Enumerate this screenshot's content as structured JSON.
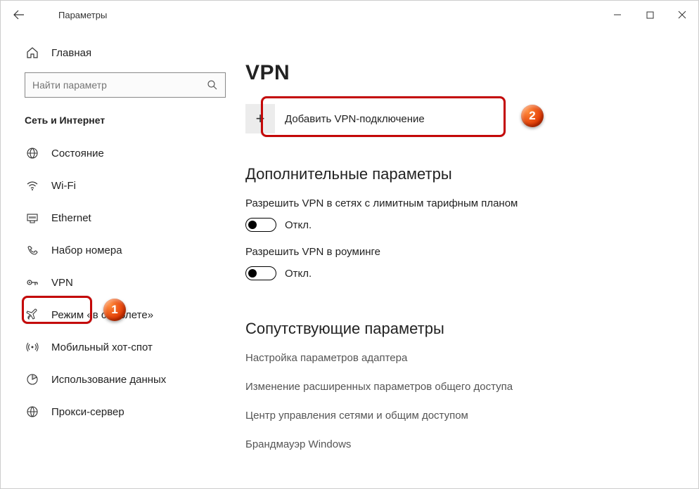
{
  "window": {
    "title": "Параметры"
  },
  "sidebar": {
    "home": "Главная",
    "search_placeholder": "Найти параметр",
    "section": "Сеть и Интернет",
    "items": [
      {
        "label": "Состояние",
        "icon": "globe-icon"
      },
      {
        "label": "Wi-Fi",
        "icon": "wifi-icon"
      },
      {
        "label": "Ethernet",
        "icon": "ethernet-icon"
      },
      {
        "label": "Набор номера",
        "icon": "dialup-icon"
      },
      {
        "label": "VPN",
        "icon": "vpn-icon",
        "selected": true
      },
      {
        "label": "Режим «в самолете»",
        "icon": "airplane-icon"
      },
      {
        "label": "Мобильный хот-спот",
        "icon": "hotspot-icon"
      },
      {
        "label": "Использование данных",
        "icon": "datausage-icon"
      },
      {
        "label": "Прокси-сервер",
        "icon": "proxy-icon"
      }
    ]
  },
  "content": {
    "page_title": "VPN",
    "add_vpn": "Добавить VPN-подключение",
    "advanced_heading": "Дополнительные параметры",
    "settings": [
      {
        "label": "Разрешить VPN в сетях с лимитным тарифным планом",
        "state": "Откл."
      },
      {
        "label": "Разрешить VPN в роуминге",
        "state": "Откл."
      }
    ],
    "related_heading": "Сопутствующие параметры",
    "related_links": [
      "Настройка параметров адаптера",
      "Изменение расширенных параметров общего доступа",
      "Центр управления сетями и общим доступом",
      "Брандмауэр Windows"
    ]
  },
  "annotations": {
    "badge1": "1",
    "badge2": "2"
  }
}
